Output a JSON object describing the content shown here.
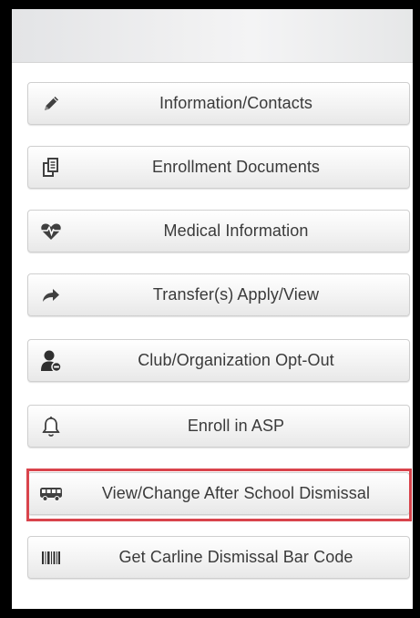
{
  "colors": {
    "frame": "#000000",
    "panel_background": "#ffffff",
    "button_text": "#3a3a3a",
    "icon": "#404040",
    "highlight_border": "#d9444c"
  },
  "menu": {
    "items": [
      {
        "label": "Information/Contacts",
        "icon": "pencil-icon"
      },
      {
        "label": "Enrollment Documents",
        "icon": "documents-icon"
      },
      {
        "label": "Medical Information",
        "icon": "heartbeat-icon"
      },
      {
        "label": "Transfer(s) Apply/View",
        "icon": "share-arrow-icon"
      },
      {
        "label": "Club/Organization Opt-Out",
        "icon": "user-minus-icon"
      },
      {
        "label": "Enroll in ASP",
        "icon": "bell-icon"
      },
      {
        "label": "View/Change After School Dismissal",
        "icon": "bus-icon"
      },
      {
        "label": "Get Carline Dismissal Bar Code",
        "icon": "barcode-icon"
      }
    ],
    "highlighted_item": "View/Change After School Dismissal"
  }
}
